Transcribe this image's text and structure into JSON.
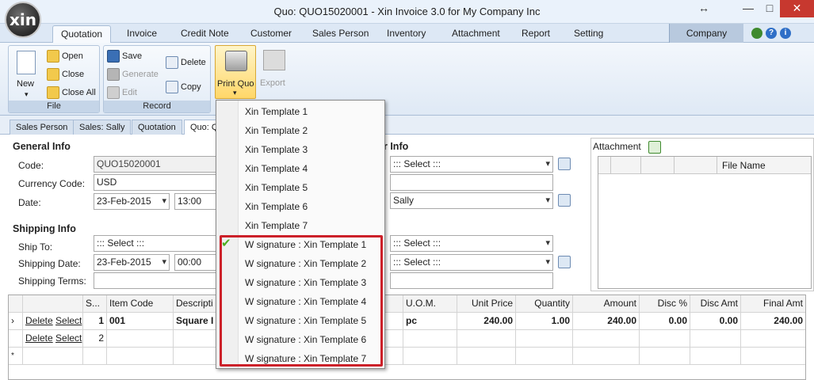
{
  "window": {
    "title": "Quo: QUO15020001 - Xin Invoice 3.0 for My Company Inc",
    "logo_text": "xin",
    "resize_glyph": "↔",
    "minimize_glyph": "—",
    "maximize_glyph": "□",
    "close_glyph": "✕"
  },
  "ribbon_tabs": [
    "Quotation",
    "Invoice",
    "Credit Note",
    "Customer",
    "Sales Person",
    "Inventory",
    "Attachment",
    "Report",
    "Setting"
  ],
  "company_tab": "Company",
  "top_icons": {
    "help_label": "?",
    "info_label": "i"
  },
  "ribbon": {
    "file": {
      "label": "File",
      "new": "New",
      "open": "Open",
      "close": "Close",
      "close_all": "Close All"
    },
    "record": {
      "label": "Record",
      "save": "Save",
      "generate": "Generate",
      "edit": "Edit",
      "delete": "Delete",
      "copy": "Copy"
    },
    "print_quo": "Print Quo",
    "export": "Export"
  },
  "doc_tabs": [
    "Sales Person",
    "Sales: Sally",
    "Quotation",
    "Quo: Q"
  ],
  "general_info": {
    "heading": "General Info",
    "code_label": "Code:",
    "code_value": "QUO15020001",
    "currency_label": "Currency Code:",
    "currency_value": "USD",
    "date_label": "Date:",
    "date_value": "23-Feb-2015",
    "time_value": "13:00"
  },
  "customer_info": {
    "heading_partial": "r Info",
    "customer_value": "::: Select :::",
    "sales_person_value": "Sally"
  },
  "shipping_info": {
    "heading": "Shipping Info",
    "ship_to_label": "Ship To:",
    "ship_to_value": "::: Select :::",
    "shipping_date_label": "Shipping Date:",
    "shipping_date_value": "23-Feb-2015",
    "shipping_time_value": "00:00",
    "shipping_terms_label": "Shipping Terms:",
    "right_select_1": "::: Select :::",
    "right_select_2": "::: Select :::"
  },
  "attachment": {
    "label": "Attachment",
    "col_file_name": "File Name"
  },
  "grid": {
    "headers": {
      "seq": "S...",
      "item_code": "Item Code",
      "description": "Descripti",
      "uom": "U.O.M.",
      "unit_price": "Unit Price",
      "quantity": "Quantity",
      "amount": "Amount",
      "disc_pct": "Disc %",
      "disc_amt": "Disc Amt",
      "final_amt": "Final Amt"
    },
    "rows": [
      {
        "marker": "›",
        "delete": "Delete",
        "select": "Select",
        "seq": "1",
        "item_code": "001",
        "description": "Square I",
        "uom": "pc",
        "unit_price": "240.00",
        "quantity": "1.00",
        "amount": "240.00",
        "disc_pct": "0.00",
        "disc_amt": "0.00",
        "final_amt": "240.00"
      },
      {
        "marker": "",
        "delete": "Delete",
        "select": "Select",
        "seq": "2",
        "item_code": "",
        "description": "",
        "uom": "",
        "unit_price": "",
        "quantity": "",
        "amount": "",
        "disc_pct": "",
        "disc_amt": "",
        "final_amt": ""
      }
    ],
    "new_row_marker": "*"
  },
  "print_menu": {
    "items": [
      "Xin Template 1",
      "Xin Template 2",
      "Xin Template 3",
      "Xin Template 4",
      "Xin Template 5",
      "Xin Template 6",
      "Xin Template 7",
      "W signature : Xin Template 1",
      "W signature : Xin Template 2",
      "W signature : Xin Template 3",
      "W signature : Xin Template 4",
      "W signature : Xin Template 5",
      "W signature : Xin Template 6",
      "W signature : Xin Template 7"
    ],
    "checked_glyph": "✔"
  },
  "colors": {
    "accent": "#cc2029",
    "check": "#4cae1f",
    "close_button": "#c7382f",
    "ribbon_bg": "#dfe9f5"
  }
}
